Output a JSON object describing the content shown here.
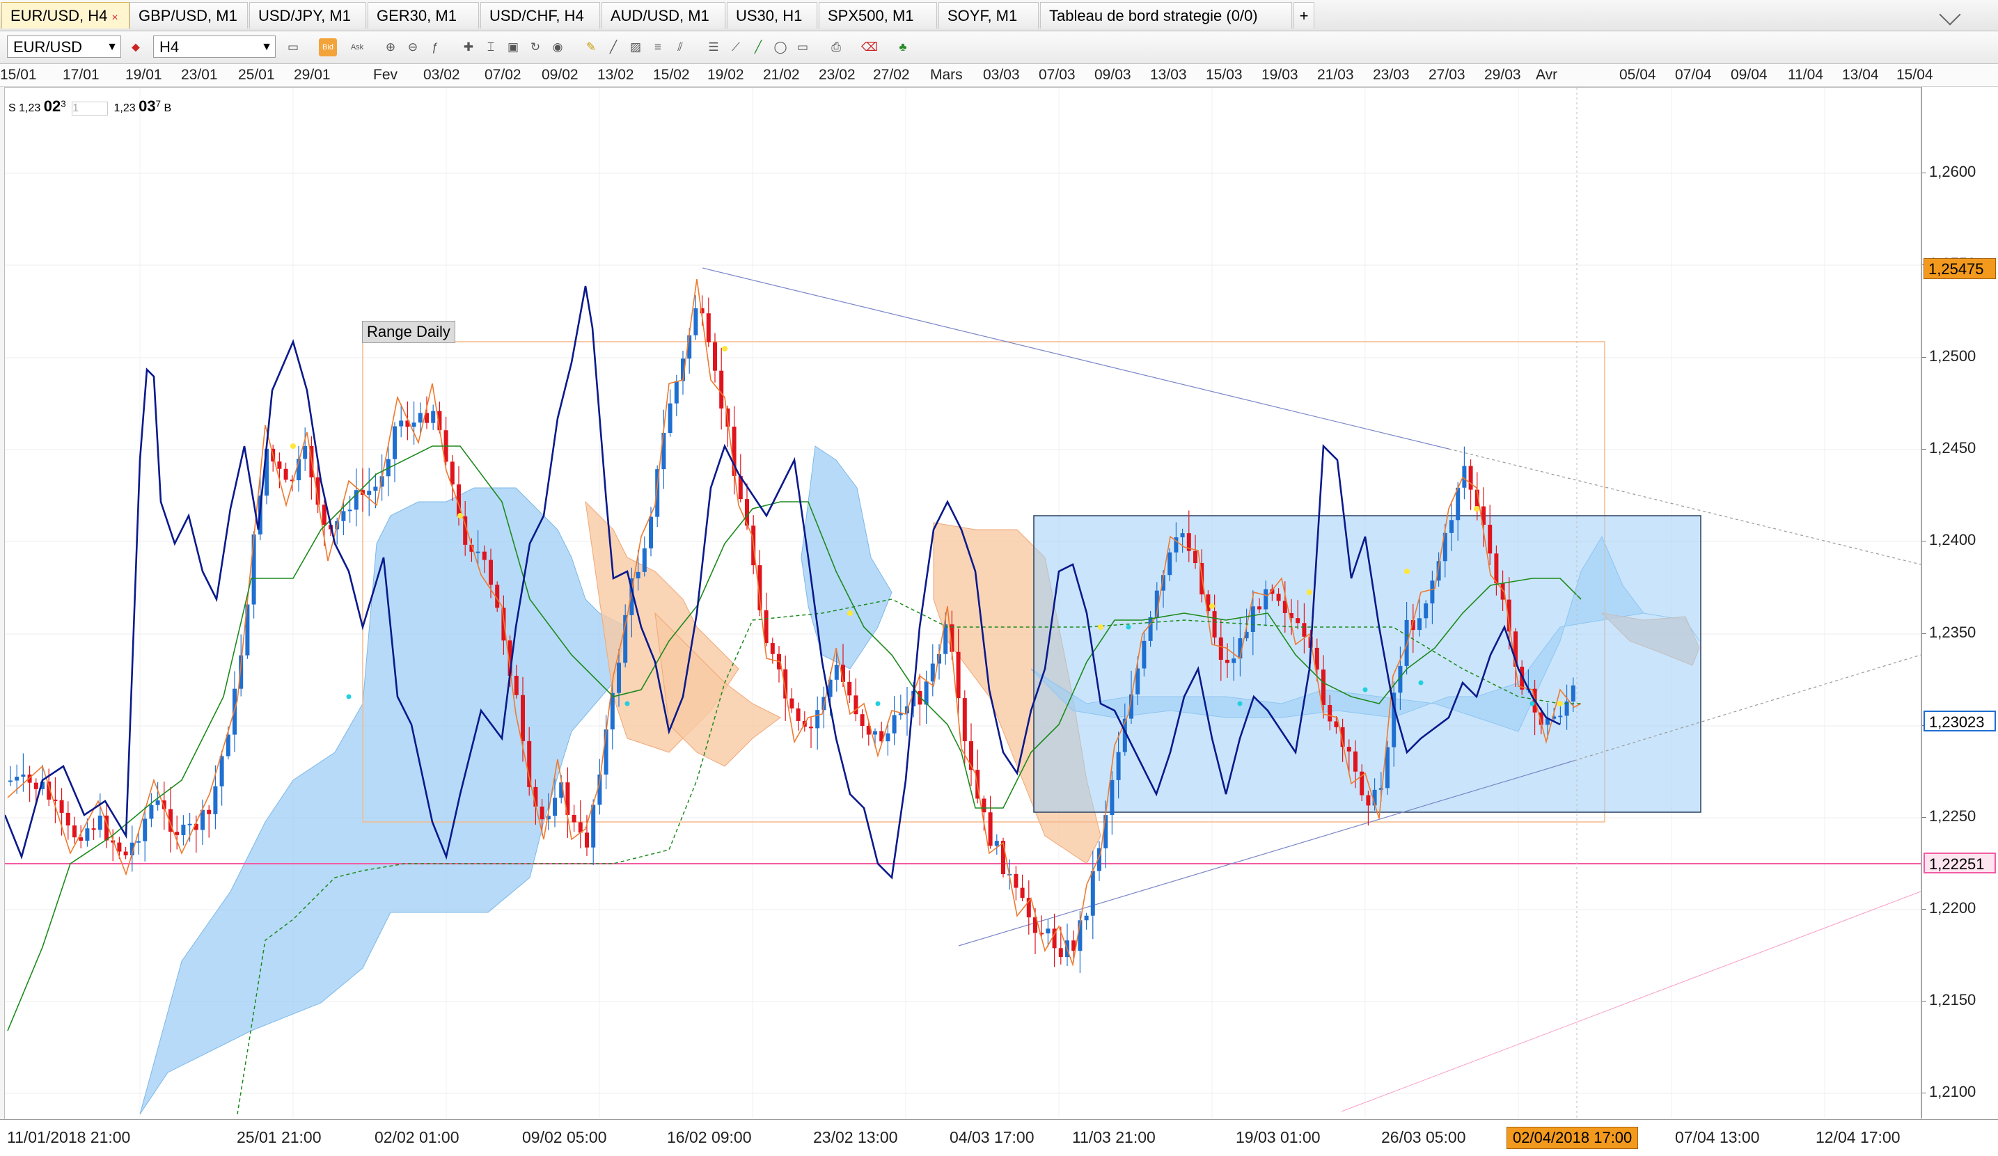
{
  "tabs": [
    {
      "label": "EUR/USD, H4",
      "active": true,
      "closable": true
    },
    {
      "label": "GBP/USD, M1"
    },
    {
      "label": "USD/JPY, M1"
    },
    {
      "label": "GER30, M1"
    },
    {
      "label": "USD/CHF, H4"
    },
    {
      "label": "AUD/USD, M1"
    },
    {
      "label": "US30, H1"
    },
    {
      "label": "SPX500, M1"
    },
    {
      "label": "SOYF, M1"
    },
    {
      "label": "Tableau de bord strategie (0/0)"
    }
  ],
  "tab_add": "+",
  "tab_close": "×",
  "toolbar": {
    "symbol": "EUR/USD",
    "timeframe": "H4",
    "bid_label": "Bid",
    "ask_label": "Ask"
  },
  "date_scale": [
    "15/01",
    "17/01",
    "19/01",
    "23/01",
    "25/01",
    "29/01",
    "Fev",
    "03/02",
    "07/02",
    "09/02",
    "13/02",
    "15/02",
    "19/02",
    "21/02",
    "23/02",
    "27/02",
    "Mars",
    "03/03",
    "07/03",
    "09/03",
    "13/03",
    "15/03",
    "19/03",
    "21/03",
    "23/03",
    "27/03",
    "29/03",
    "Avr",
    "05/04",
    "07/04",
    "09/04",
    "11/04",
    "13/04",
    "15/04"
  ],
  "info_panel": {
    "s_label": "S",
    "s_small": "1,23",
    "s_big": "02",
    "s_sup": "3",
    "sep": "1",
    "b_small": "1,23",
    "b_big": "03",
    "b_sup": "7",
    "b_label": "B"
  },
  "price_axis": {
    "ticks": [
      "1,2600",
      "1,2550",
      "1,2500",
      "1,2450",
      "1,2400",
      "1,2350",
      "1,2300",
      "1,2250",
      "1,2200",
      "1,2150",
      "1,2100"
    ],
    "badge_high": "1,25475",
    "badge_current": "1,23023",
    "badge_line": "1,22251"
  },
  "time_axis": {
    "labels": [
      "11/01/2018 21:00",
      "25/01 21:00",
      "02/02 01:00",
      "09/02 05:00",
      "16/02 09:00",
      "23/02 13:00",
      "04/03 17:00",
      "11/03 21:00",
      "19/03 01:00",
      "26/03 05:00",
      "07/04 13:00",
      "12/04 17:00"
    ],
    "cursor_label": "02/04/2018 17:00"
  },
  "range_label": "Range Daily",
  "colors": {
    "bull": "#1f6fd1",
    "bear": "#e0141c",
    "kumo_bull": "#9dcdf4",
    "kumo_bear": "#f7c9a3",
    "oscillator": "#0a1a8c",
    "kijun": "#1d8a1d",
    "tenkan": "#f07a2e",
    "hline": "#f35ba2",
    "range_box": "#f6b98c",
    "box_fill": "#9ecff7",
    "badge_orange": "#f39a1e",
    "badge_pink": "#f35ba2"
  }
}
